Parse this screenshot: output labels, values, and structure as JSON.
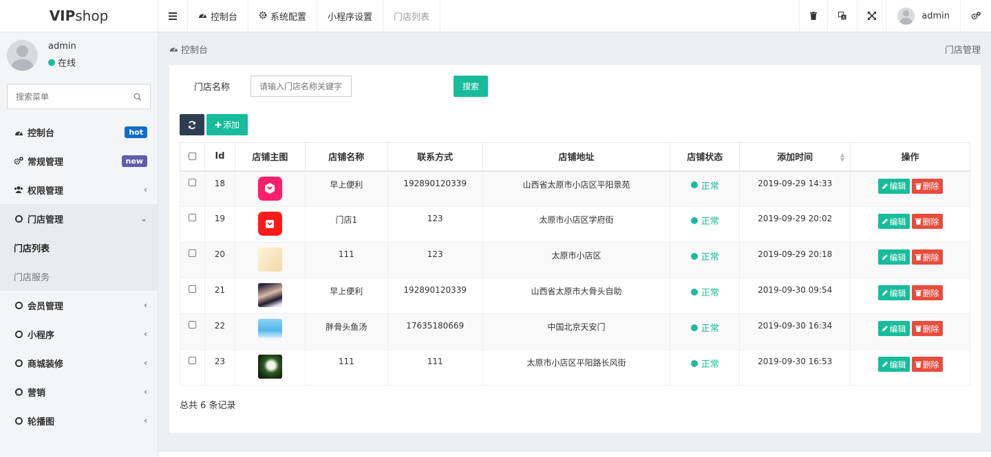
{
  "logo": {
    "bold": "VIP",
    "light": "shop"
  },
  "user": {
    "name": "admin",
    "status": "在线"
  },
  "sidebar_search": {
    "placeholder": "搜索菜单"
  },
  "menu": {
    "dashboard": {
      "label": "控制台",
      "badge": "hot"
    },
    "general": {
      "label": "常规管理",
      "badge": "new"
    },
    "auth": {
      "label": "权限管理"
    },
    "store": {
      "label": "门店管理"
    },
    "store_list": {
      "label": "门店列表"
    },
    "store_service": {
      "label": "门店服务"
    },
    "member": {
      "label": "会员管理"
    },
    "miniapp": {
      "label": "小程序"
    },
    "decor": {
      "label": "商城装修"
    },
    "marketing": {
      "label": "营销"
    },
    "carousel": {
      "label": "轮播图"
    }
  },
  "topnav": {
    "dashboard": "控制台",
    "sysconfig": "系统配置",
    "miniapp_settings": "小程序设置",
    "store_list": "门店列表",
    "username": "admin"
  },
  "breadcrumb": {
    "label": "控制台",
    "page": "门店管理"
  },
  "filter": {
    "label": "门店名称",
    "placeholder": "请输入门店名称关键字",
    "search": "搜索"
  },
  "toolbar": {
    "add": "添加"
  },
  "table": {
    "headers": {
      "id": "Id",
      "image": "店铺主图",
      "name": "店铺名称",
      "contact": "联系方式",
      "address": "店铺地址",
      "status": "店铺状态",
      "time": "添加时间",
      "ops": "操作"
    },
    "rows": [
      {
        "id": "18",
        "name": "早上便利",
        "contact": "192890120339",
        "address": "山西省太原市小店区平阳景苑",
        "status": "正常",
        "time": "2019-09-29 14:33"
      },
      {
        "id": "19",
        "name": "门店1",
        "contact": "123",
        "address": "太原市小店区学府街",
        "status": "正常",
        "time": "2019-09-29 20:02"
      },
      {
        "id": "20",
        "name": "111",
        "contact": "123",
        "address": "太原市小店区",
        "status": "正常",
        "time": "2019-09-29 20:18"
      },
      {
        "id": "21",
        "name": "早上便利",
        "contact": "192890120339",
        "address": "山西省太原市大骨头自助",
        "status": "正常",
        "time": "2019-09-30 09:54"
      },
      {
        "id": "22",
        "name": "胖骨头鱼汤",
        "contact": "17635180669",
        "address": "中国北京天安门",
        "status": "正常",
        "time": "2019-09-30 16:34"
      },
      {
        "id": "23",
        "name": "111",
        "contact": "111",
        "address": "太原市小店区平阳路长风街",
        "status": "正常",
        "time": "2019-09-30 16:53"
      }
    ],
    "edit_label": "编辑",
    "delete_label": "删除"
  },
  "total": "总共 6 条记录"
}
